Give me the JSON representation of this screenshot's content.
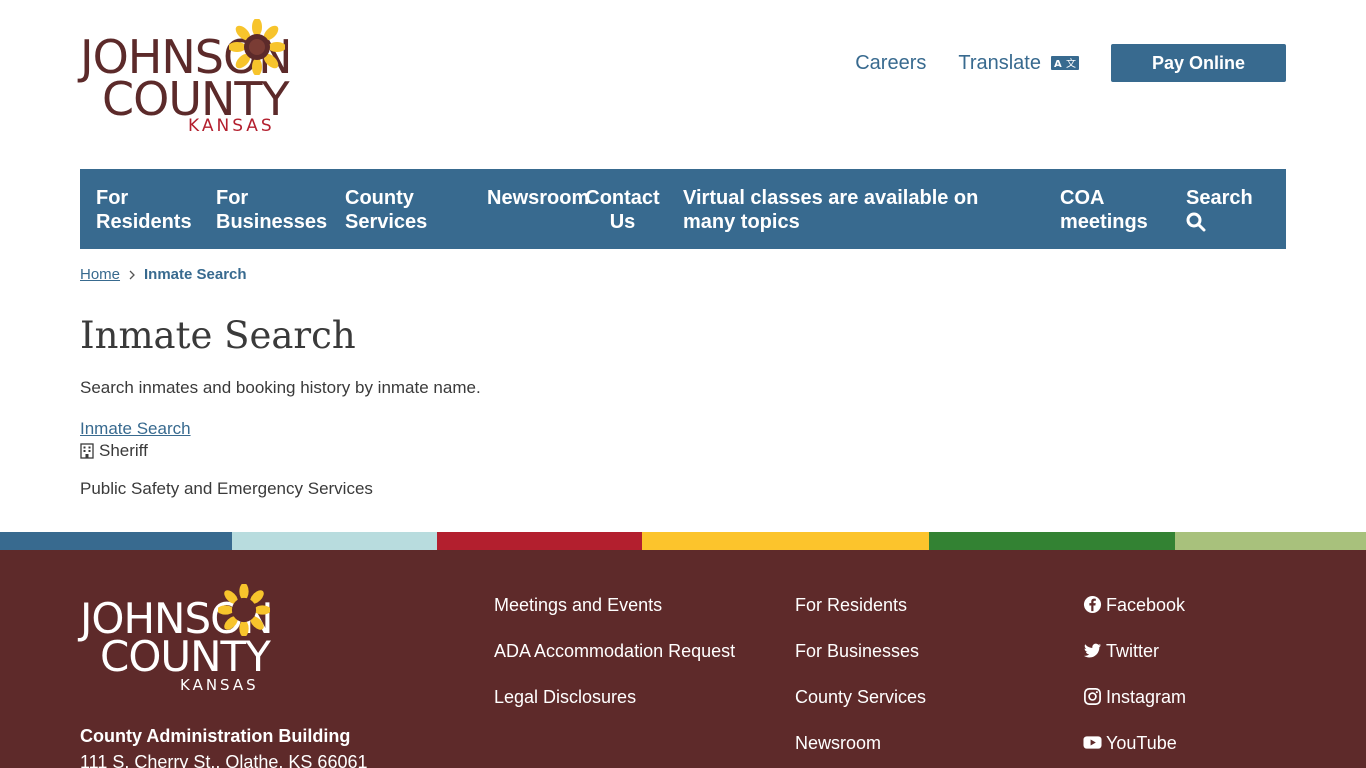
{
  "header": {
    "logo": {
      "line1": "JOHNSON",
      "line2": "COUNTY",
      "line3": "KANSAS"
    },
    "links": {
      "careers": "Careers",
      "translate": "Translate"
    },
    "pay_button": "Pay Online",
    "icons": {
      "translate": "translate-icon",
      "sunflower": "sunflower-logo"
    }
  },
  "nav": {
    "items": [
      {
        "label": "For Residents"
      },
      {
        "label": "For Businesses"
      },
      {
        "label": "County Services"
      },
      {
        "label": "Newsroom"
      },
      {
        "label": "Contact Us"
      },
      {
        "label": "Virtual classes are available on many topics"
      },
      {
        "label": "COA meetings"
      },
      {
        "label": "Search"
      }
    ]
  },
  "breadcrumb": {
    "home": "Home",
    "current": "Inmate Search"
  },
  "main": {
    "title": "Inmate Search",
    "description": "Search inmates and booking history by inmate name.",
    "result_link": "Inmate Search",
    "department": "Sheriff",
    "category": "Public Safety and Emergency Services"
  },
  "colors": {
    "primary_blue": "#386a8f",
    "footer_maroon": "#5e2a2a",
    "stripe": [
      "#386a8f",
      "#b8dcde",
      "#b31f2e",
      "#fcc42c",
      "#338233",
      "#a8c17c"
    ]
  },
  "footer": {
    "logo": {
      "line1": "JOHNSON",
      "line2": "COUNTY",
      "line3": "KANSAS"
    },
    "address_title": "County Administration Building",
    "address_line": "111 S. Cherry St., Olathe, KS 66061",
    "col1": [
      "Meetings and Events",
      "ADA Accommodation Request",
      "Legal Disclosures"
    ],
    "col2": [
      "For Residents",
      "For Businesses",
      "County Services",
      "Newsroom"
    ],
    "social": [
      {
        "label": "Facebook",
        "icon": "facebook-icon"
      },
      {
        "label": "Twitter",
        "icon": "twitter-icon"
      },
      {
        "label": "Instagram",
        "icon": "instagram-icon"
      },
      {
        "label": "YouTube",
        "icon": "youtube-icon"
      }
    ]
  }
}
